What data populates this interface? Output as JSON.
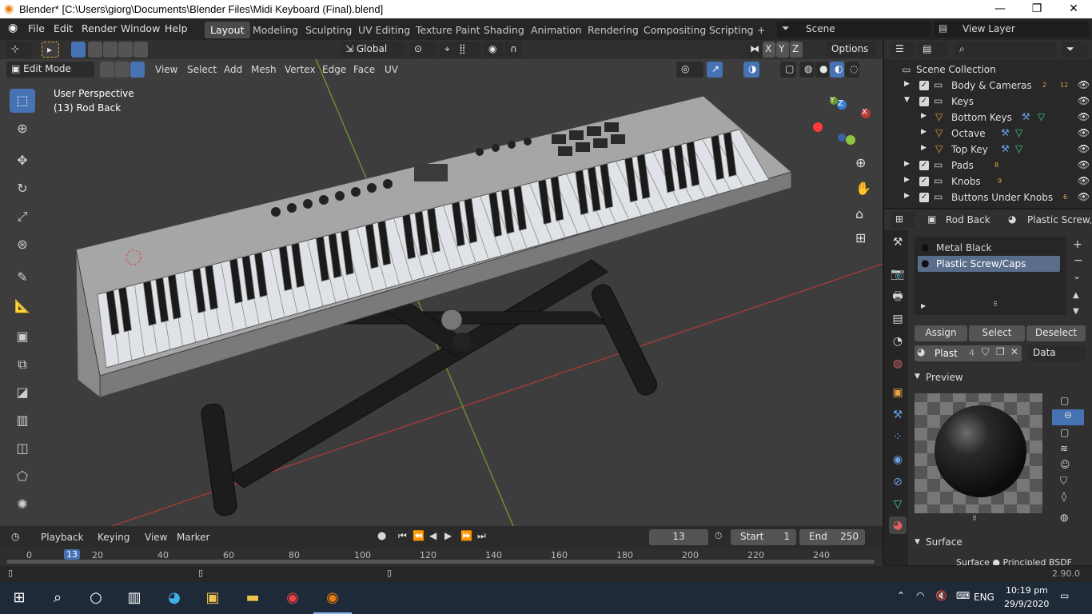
{
  "titlebar": {
    "title": "Blender* [C:\\Users\\giorg\\Documents\\Blender Files\\Midi Keyboard (Final).blend]",
    "minimize": "—",
    "restore": "❐",
    "close": "✕"
  },
  "menu": {
    "file": "File",
    "edit": "Edit",
    "render": "Render",
    "window": "Window",
    "help": "Help"
  },
  "workspaces": [
    "Layout",
    "Modeling",
    "Sculpting",
    "UV Editing",
    "Texture Paint",
    "Shading",
    "Animation",
    "Rendering",
    "Compositing",
    "Scripting"
  ],
  "workspace_add": "+",
  "scene": {
    "label": "Scene",
    "view_layer": "View Layer"
  },
  "viewport": {
    "transform_orientation": "Global",
    "axes": [
      "X",
      "Y",
      "Z"
    ],
    "options": "Options",
    "mode": "Edit Mode",
    "menus": [
      "View",
      "Select",
      "Add",
      "Mesh",
      "Vertex",
      "Edge",
      "Face",
      "UV"
    ],
    "overlay_title": "User Perspective",
    "overlay_object": "(13) Rod Back",
    "gizmo": {
      "x": "X",
      "y": "Y",
      "z": "Z"
    }
  },
  "outliner": {
    "root": "Scene Collection",
    "rows": [
      {
        "name": "Body & Cameras",
        "badge1": "2",
        "badge2": "12"
      },
      {
        "name": "Keys"
      },
      {
        "name": "Bottom Keys"
      },
      {
        "name": "Octave"
      },
      {
        "name": "Top Key"
      },
      {
        "name": "Pads",
        "badge1": "8"
      },
      {
        "name": "Knobs",
        "badge1": "9"
      },
      {
        "name": "Buttons Under Knobs",
        "badge1": "6"
      }
    ]
  },
  "properties": {
    "object": "Rod Back",
    "material_header": "Plastic Screw/Caps",
    "slots": [
      "Metal Black",
      "Plastic Screw/Caps"
    ],
    "assign": "Assign",
    "select": "Select",
    "deselect": "Deselect",
    "mat_name": "Plast",
    "mat_users": "4",
    "link": "Data",
    "preview": "Preview",
    "surface": "Surface",
    "surface_value": "Surface ● Principled BSDF"
  },
  "timeline": {
    "playback": "Playback",
    "keying": "Keying",
    "view": "View",
    "marker": "Marker",
    "current_frame": "13",
    "start_label": "Start",
    "start": "1",
    "end_label": "End",
    "end": "250",
    "ticks": [
      "0",
      "20",
      "40",
      "60",
      "80",
      "100",
      "120",
      "140",
      "160",
      "180",
      "200",
      "220",
      "240"
    ]
  },
  "status": {
    "version": "2.90.0"
  },
  "taskbar": {
    "lang": "ENG",
    "time": "10:19 pm",
    "date": "29/9/2020"
  },
  "colors": {
    "accent": "#4772b3",
    "x_axis": "#c0392b",
    "y_axis": "#7ea33a",
    "origin": "#ff8c00"
  }
}
